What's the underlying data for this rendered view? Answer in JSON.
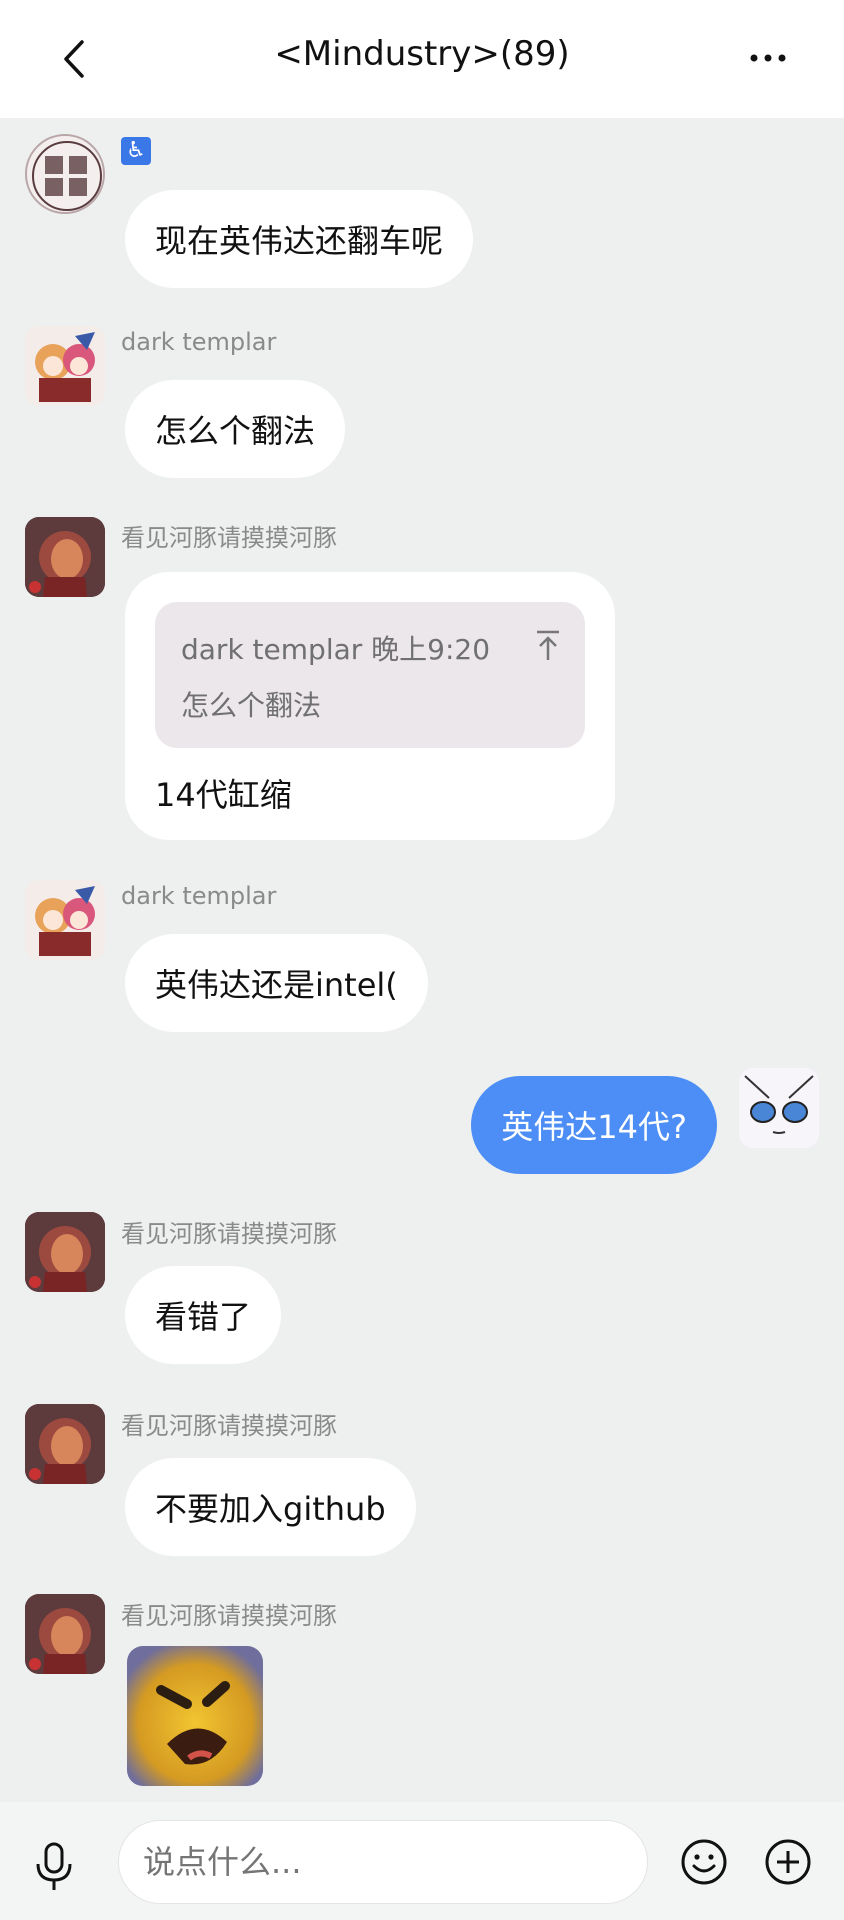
{
  "header": {
    "title": "<Mindustry>(89)",
    "back_icon": "chevron-left-icon",
    "more_icon": "more-dots-icon"
  },
  "messages": [
    {
      "sender": "",
      "badge": "♿",
      "text": "现在英伟达还翻车呢"
    },
    {
      "sender": "dark templar",
      "text": "怎么个翻法"
    },
    {
      "sender": "看见河豚请摸摸河豚",
      "quote": {
        "author_time": "dark templar 晚上9:20",
        "text": "怎么个翻法"
      },
      "text": "14代缸缩"
    },
    {
      "sender": "dark templar",
      "text": "英伟达还是intel("
    },
    {
      "sender": "self",
      "text": "英伟达14代?"
    },
    {
      "sender": "看见河豚请摸摸河豚",
      "text": "看错了"
    },
    {
      "sender": "看见河豚请摸摸河豚",
      "text": "不要加入github"
    },
    {
      "sender": "看见河豚请摸摸河豚",
      "sticker": "angry-face-sticker"
    }
  ],
  "input": {
    "placeholder": "说点什么...",
    "mic_icon": "microphone-icon",
    "emoji_icon": "emoji-icon",
    "plus_icon": "plus-circle-icon"
  },
  "colors": {
    "background": "#edf0ef",
    "self_bubble": "#4c8ef5",
    "other_bubble": "#ffffff"
  }
}
